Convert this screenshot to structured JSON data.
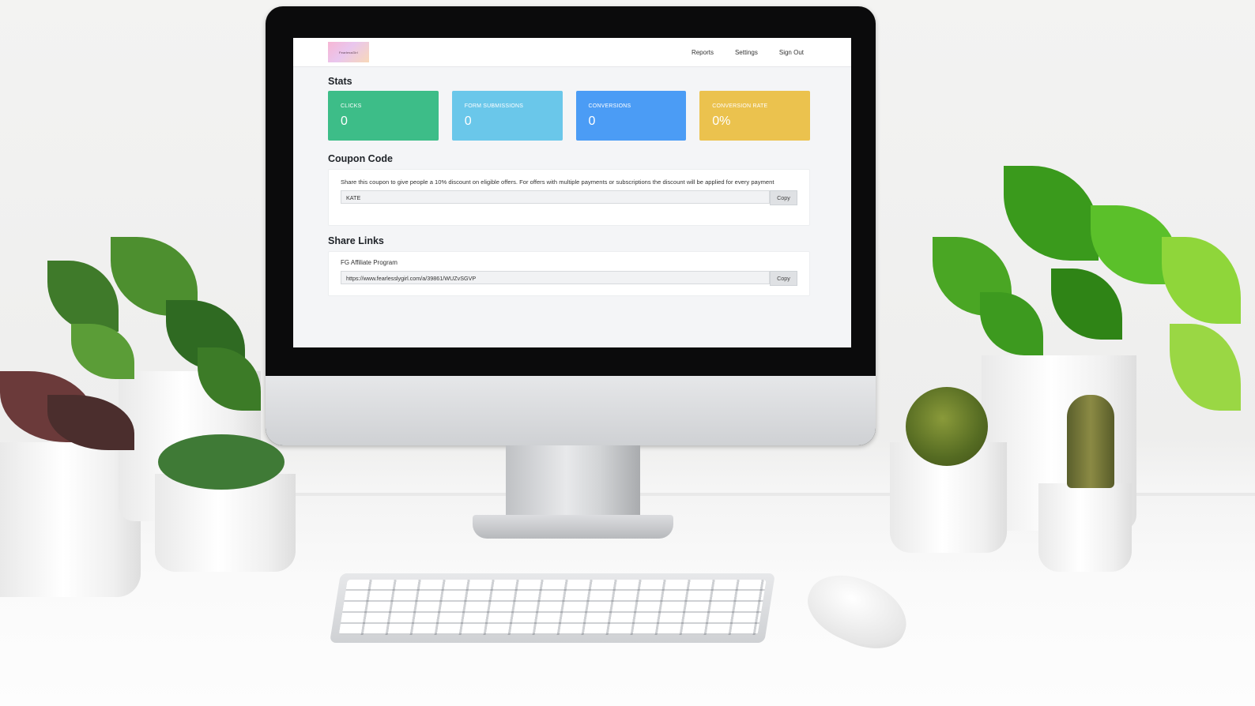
{
  "nav": {
    "logo_text": "FearlessGirl",
    "links": [
      "Reports",
      "Settings",
      "Sign Out"
    ]
  },
  "stats": {
    "heading": "Stats",
    "cards": [
      {
        "label": "CLICKS",
        "value": "0",
        "color": "#3dbd88"
      },
      {
        "label": "FORM SUBMISSIONS",
        "value": "0",
        "color": "#6ac7ea"
      },
      {
        "label": "CONVERSIONS",
        "value": "0",
        "color": "#4b9cf5"
      },
      {
        "label": "CONVERSION RATE",
        "value": "0%",
        "color": "#ebc24e"
      }
    ]
  },
  "coupon": {
    "heading": "Coupon Code",
    "description": "Share this coupon to give people a 10% discount on eligible offers. For offers with multiple payments or subscriptions the discount will be applied for every payment",
    "code": "KATE",
    "copy_label": "Copy"
  },
  "share_links": {
    "heading": "Share Links",
    "items": [
      {
        "name": "FG Affiliate Program",
        "url": "https://www.fearlesslygirl.com/a/39861/WUZvSGVP",
        "copy_label": "Copy"
      }
    ]
  }
}
